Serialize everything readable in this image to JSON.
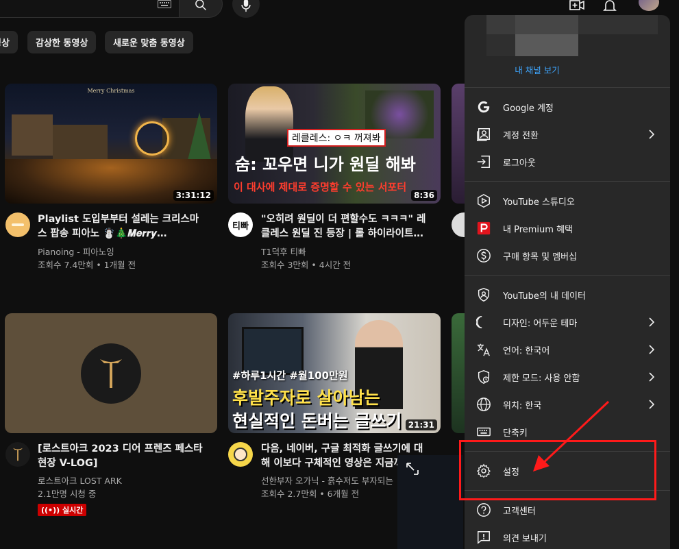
{
  "topbar": {
    "search_placeholder": "",
    "keyboard_icon": "keyboard-icon",
    "search_icon": "search-icon",
    "mic_icon": "mic-icon",
    "create_icon": "create-video-icon",
    "bell_icon": "bell-icon"
  },
  "chips": [
    {
      "label": "영상"
    },
    {
      "label": "감상한 동영상"
    },
    {
      "label": "새로운 맞춤 동영상"
    }
  ],
  "videos": [
    {
      "title_line1": "Playlist 도입부부터 설레는 크리스마",
      "title_line2": "스 팝송 피아노 ☃️🎄𝑴𝒆𝒓𝒓𝒚…",
      "channel": "Pianoing - 피아노잉",
      "meta": "조회수 7.4만회 • 1개월 전",
      "duration": "3:31:12",
      "thumb_text": "Merry Christmas"
    },
    {
      "title_line1": "\"오히려 원딜이 더 편할수도 ㅋㅋㅋ\" 레",
      "title_line2": "클레스 원딜 진 등장 | 롤 하이라이트…",
      "channel": "T1덕후 티빠",
      "meta": "조회수 3만회 • 4시간 전",
      "duration": "8:36",
      "avatar_text": "티빠",
      "thumb_caption": "레클레스: ㅇㅋ 꺼져봐",
      "thumb_big": "숨: 꼬우면 니가 원딜 해봐",
      "thumb_sub": "이 대사에 제대로 증명할 수 있는 서포터"
    },
    {
      "title_line1": "[로스트아크 2023 디어 프렌즈 페스타",
      "title_line2": "현장 V-LOG]",
      "channel": "로스트아크 LOST ARK",
      "meta": "2.1만명 시청 중",
      "live": "((•)) 실시간"
    },
    {
      "title_line1": "다음, 네이버, 구글 최적화 글쓰기에 대",
      "title_line2": "해 이보다 구체적인 영상은 지금까",
      "channel": "선한부자 오가닉 - 흙수저도 부자되는",
      "meta": "조회수 2.7만회 • 6개월 전",
      "duration": "21:31",
      "thumb_tags": "#하루1시간 #월100만원",
      "thumb_big": "후발주자로 살아남는",
      "thumb_big2": "현실적인 돈버는 글쓰기"
    }
  ],
  "menu": {
    "channel_link": "내 채널 보기",
    "items": [
      {
        "label": "Google 계정",
        "icon": "google-icon"
      },
      {
        "label": "계정 전환",
        "icon": "switch-account-icon",
        "chevron": true
      },
      {
        "label": "로그아웃",
        "icon": "sign-out-icon"
      },
      {
        "label": "YouTube 스튜디오",
        "icon": "studio-icon"
      },
      {
        "label": "내 Premium 혜택",
        "icon": "premium-icon"
      },
      {
        "label": "구매 항목 및 멤버십",
        "icon": "purchases-icon"
      },
      {
        "label": "YouTube의 내 데이터",
        "icon": "shield-icon"
      },
      {
        "label": "디자인: 어두운 테마",
        "icon": "moon-icon",
        "chevron": true
      },
      {
        "label": "언어: 한국어",
        "icon": "translate-icon",
        "chevron": true
      },
      {
        "label": "제한 모드: 사용 안함",
        "icon": "restricted-icon",
        "chevron": true
      },
      {
        "label": "위치: 한국",
        "icon": "globe-icon",
        "chevron": true
      },
      {
        "label": "단축키",
        "icon": "keyboard-icon"
      },
      {
        "label": "설정",
        "icon": "gear-icon"
      },
      {
        "label": "고객센터",
        "icon": "help-icon"
      },
      {
        "label": "의견 보내기",
        "icon": "feedback-icon"
      }
    ]
  },
  "colors": {
    "bg": "#0f0f0f",
    "menu_bg": "#282828",
    "link": "#3ea6ff",
    "annotation": "#ff1a1a",
    "live": "#cc0000"
  }
}
